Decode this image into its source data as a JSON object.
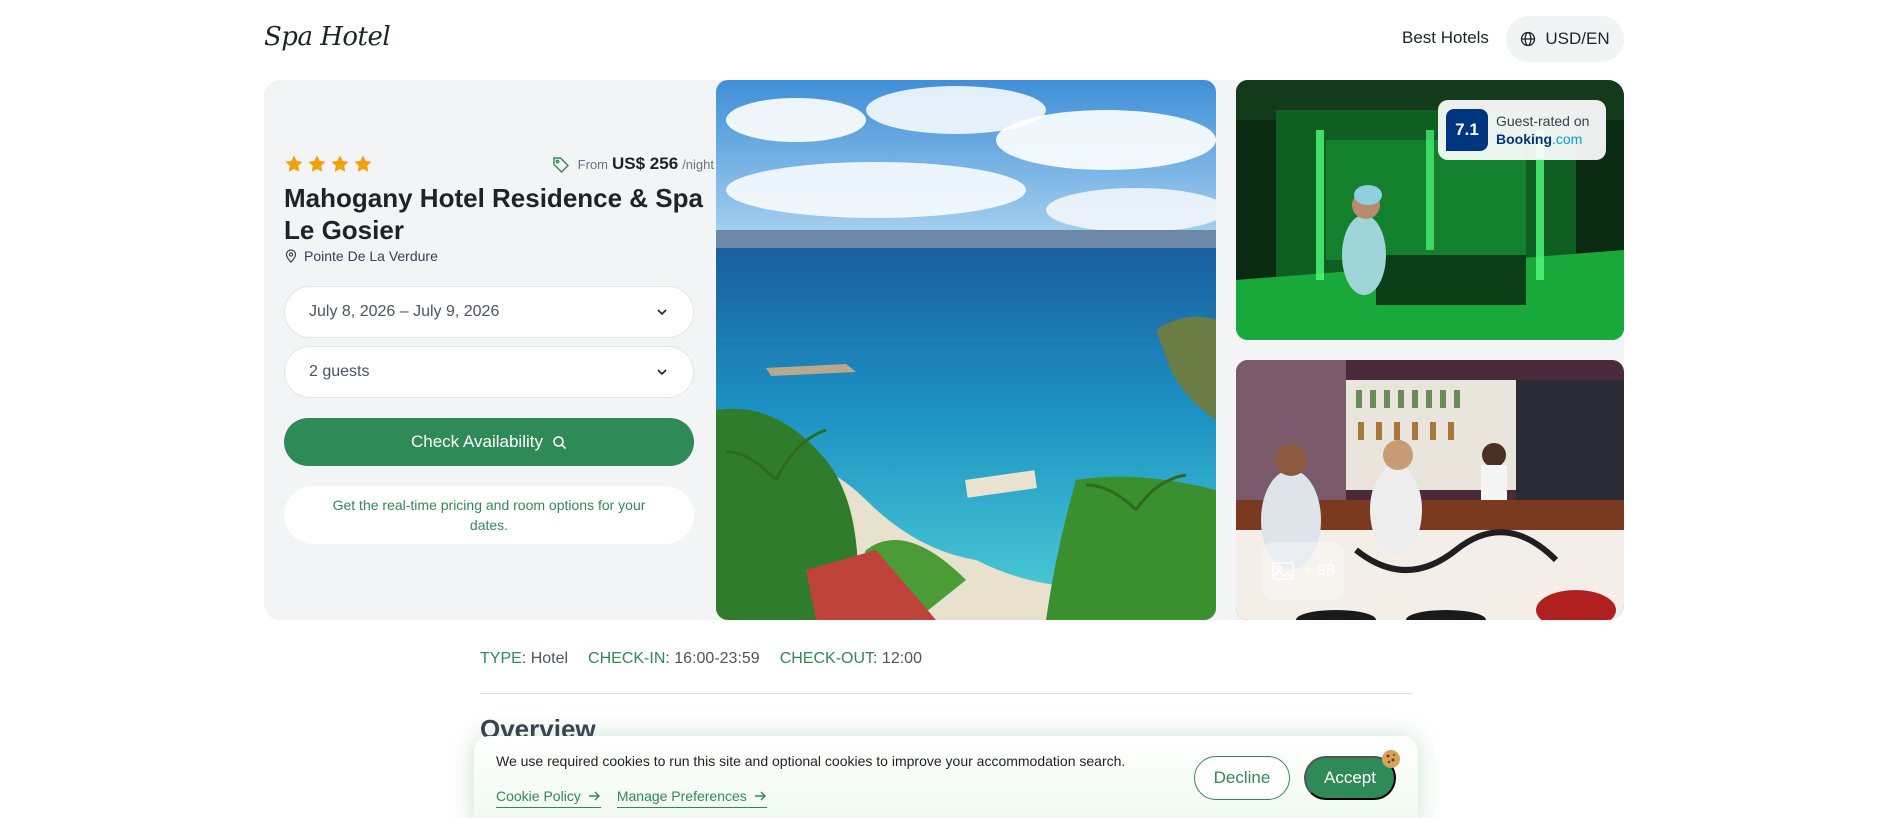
{
  "header": {
    "logo": "Spa Hotel",
    "nav_link": "Best Hotels",
    "currency_label": "USD/EN"
  },
  "hotel": {
    "stars": 4,
    "price_prefix": "From",
    "price": "US$ 256",
    "price_suffix": "/night",
    "name": "Mahogany Hotel Residence & Spa Le Gosier",
    "location": "Pointe De La Verdure"
  },
  "booking": {
    "dates_value": "July 8, 2026 – July 9, 2026",
    "guests_value": "2 guests",
    "check_button": "Check Availability",
    "hint": "Get the real-time pricing and room options for your dates."
  },
  "rating": {
    "score": "7.1",
    "line1": "Guest-rated on",
    "brand_name": "Booking",
    "brand_tld": ".com"
  },
  "gallery": {
    "more_count": "+ 98"
  },
  "info": {
    "type_label": "TYPE",
    "type_value": ": Hotel",
    "checkin_label": "CHECK-IN",
    "checkin_value": ": 16:00-23:59",
    "checkout_label": "CHECK-OUT",
    "checkout_value": ": 12:00"
  },
  "section": {
    "overview": "Overview"
  },
  "cookie": {
    "message": "We use required cookies to run this site and optional cookies to improve your accommodation search.",
    "policy_link": "Cookie Policy",
    "preferences_link": "Manage Preferences",
    "decline": "Decline",
    "accept": "Accept"
  },
  "colors": {
    "accent_green": "#2e8b57",
    "star_orange": "#f59e0b",
    "booking_blue": "#003580"
  },
  "icons": [
    "globe-icon",
    "star-icon",
    "tag-icon",
    "pin-icon",
    "chevron-down-icon",
    "search-icon",
    "image-icon",
    "arrow-right-icon",
    "cookie-icon"
  ]
}
